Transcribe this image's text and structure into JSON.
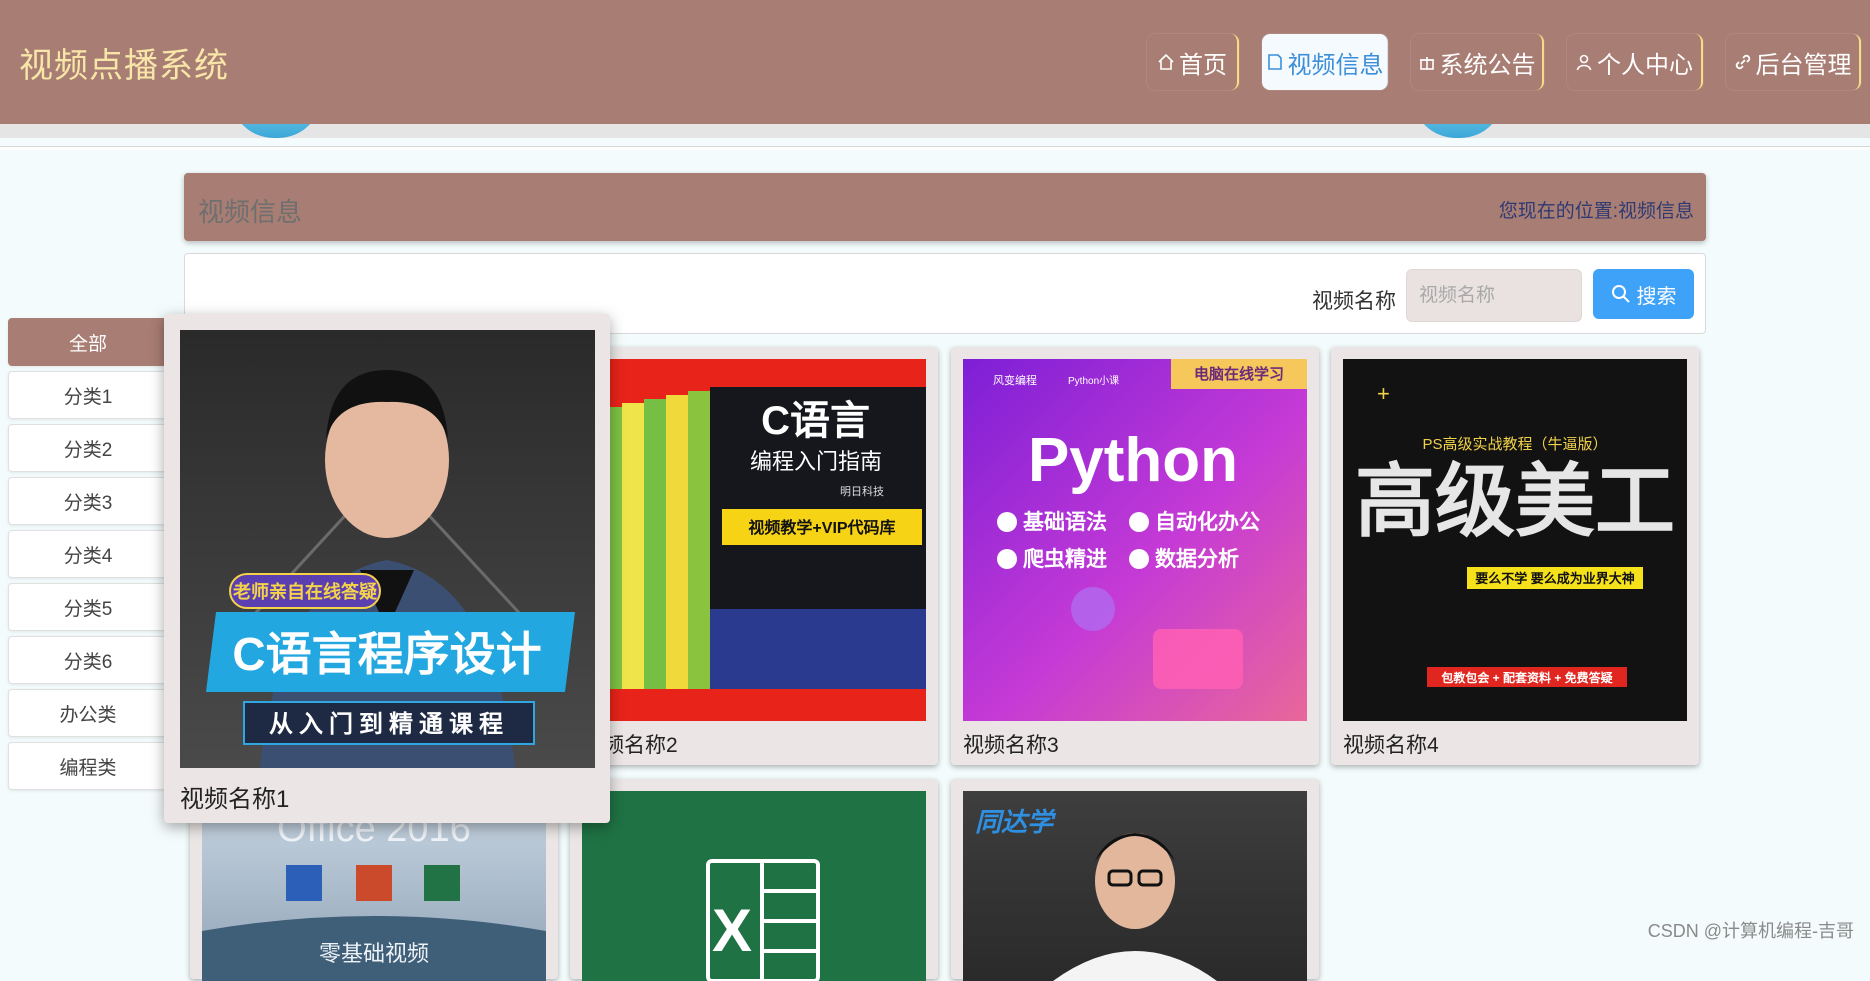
{
  "header": {
    "site_title": "视频点播系统",
    "nav": [
      {
        "label": "首页",
        "icon": "home-icon"
      },
      {
        "label": "视频信息",
        "icon": "document-icon",
        "active": true
      },
      {
        "label": "系统公告",
        "icon": "gift-icon"
      },
      {
        "label": "个人中心",
        "icon": "user-icon"
      },
      {
        "label": "后台管理",
        "icon": "link-icon"
      }
    ]
  },
  "page": {
    "title": "视频信息",
    "location_prefix": "您现在的位置:",
    "location_current": "视频信息"
  },
  "search": {
    "label": "视频名称",
    "placeholder": "视频名称",
    "button_label": "搜索"
  },
  "sidebar": {
    "items": [
      "全部",
      "分类1",
      "分类2",
      "分类3",
      "分类4",
      "分类5",
      "分类6",
      "办公类",
      "编程类"
    ]
  },
  "cards": [
    {
      "name": "视频名称1",
      "poster": {
        "badge": "老师亲自在线答疑",
        "title": "C语言程序设计",
        "subtitle": "从入门到精通课程"
      }
    },
    {
      "name": "视频名称2",
      "poster": {
        "title": "C语言",
        "subtitle": "编程入门指南",
        "tag": "视频教学+VIP代码库",
        "publisher": "明日科技"
      }
    },
    {
      "name": "视频名称3",
      "poster": {
        "brand": "风变编程",
        "brand2": "Python小课",
        "corner": "电脑在线学习",
        "title": "Python",
        "features": [
          "基础语法",
          "自动化办公",
          "爬虫精进",
          "数据分析"
        ]
      }
    },
    {
      "name": "视频名称4",
      "poster": {
        "kicker": "PS高级实战教程（牛逼版）",
        "title": "高级美工",
        "slogan": "要么不学 要么成为业界大神",
        "bonus": "包教包会 + 配套资料 + 免费答疑"
      }
    },
    {
      "name": "",
      "poster": {
        "title": "Office 2016",
        "subtitle": "零基础视频"
      }
    },
    {
      "name": "",
      "poster": {
        "title": "X"
      }
    },
    {
      "name": "",
      "poster": {
        "brand": "同达学"
      }
    }
  ],
  "watermark": "CSDN @计算机编程-吉哥"
}
